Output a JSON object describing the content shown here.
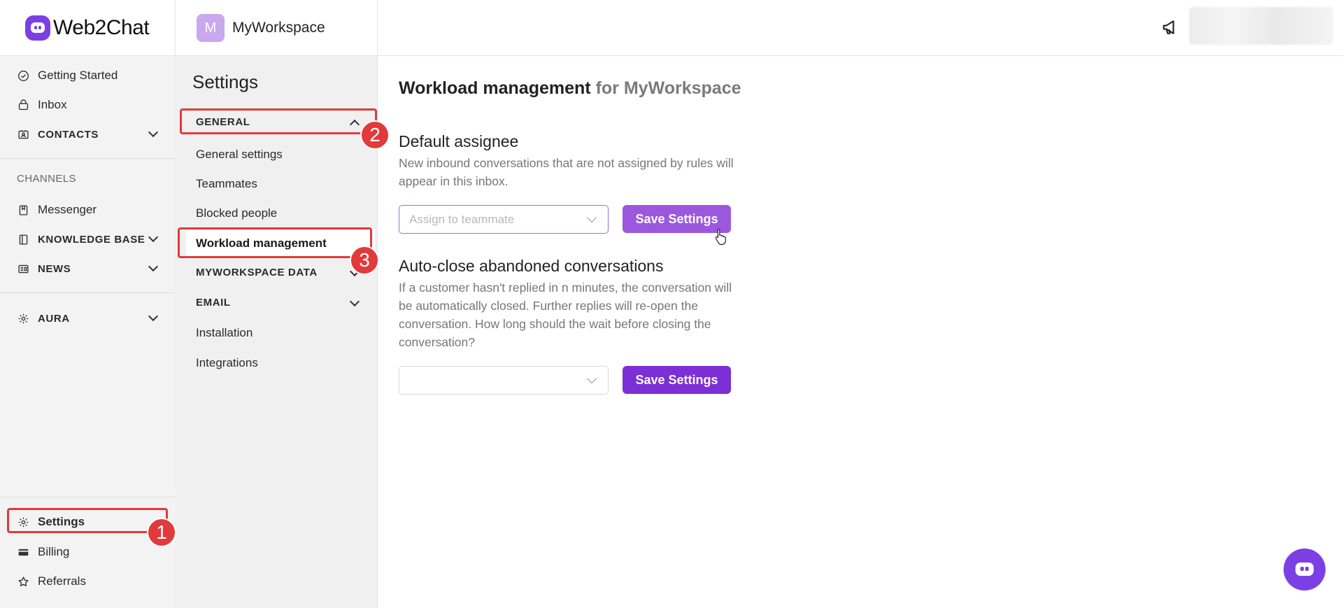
{
  "app": {
    "name": "Web2Chat"
  },
  "workspace": {
    "initial": "M",
    "name": "MyWorkspace"
  },
  "sidebar": {
    "items": [
      {
        "label": "Getting Started",
        "icon": "check-circle-icon"
      },
      {
        "label": "Inbox",
        "icon": "inbox-icon"
      },
      {
        "label": "CONTACTS",
        "icon": "contacts-icon",
        "expandable": true
      }
    ],
    "channels_label": "CHANNELS",
    "channels": [
      {
        "label": "Messenger",
        "icon": "messenger-icon"
      },
      {
        "label": "KNOWLEDGE BASE",
        "icon": "book-icon",
        "expandable": true
      },
      {
        "label": "NEWS",
        "icon": "news-icon",
        "expandable": true
      }
    ],
    "aura": {
      "label": "AURA",
      "icon": "gear-icon",
      "expandable": true
    },
    "bottom": [
      {
        "label": "Settings",
        "icon": "gear-icon"
      },
      {
        "label": "Billing",
        "icon": "credit-card-icon"
      },
      {
        "label": "Referrals",
        "icon": "star-icon"
      }
    ]
  },
  "settings_panel": {
    "title": "Settings",
    "general": "GENERAL",
    "items": [
      "General settings",
      "Teammates",
      "Blocked people",
      "Workload management"
    ],
    "active": "Workload management",
    "groups": [
      "MYWORKSPACE DATA",
      "EMAIL"
    ],
    "extras": [
      "Installation",
      "Integrations"
    ]
  },
  "main": {
    "title": "Workload management",
    "title_suffix": "for MyWorkspace",
    "default_assignee": {
      "title": "Default assignee",
      "description": "New inbound conversations that are not assigned by rules will appear in this inbox.",
      "select_placeholder": "Assign to teammate",
      "button": "Save Settings"
    },
    "auto_close": {
      "title": "Auto-close abandoned conversations",
      "description": "If a customer hasn't replied in n minutes, the conversation will be automatically closed. Further replies will re-open the conversation. How long should the wait before closing the conversation?",
      "select_value": "",
      "button": "Save Settings"
    }
  },
  "annotations": [
    "1",
    "2",
    "3"
  ],
  "colors": {
    "accent": "#7b3fe4",
    "button_light": "#9b58dd",
    "button_dark": "#7c2fd4",
    "highlight": "#e23a3a"
  }
}
